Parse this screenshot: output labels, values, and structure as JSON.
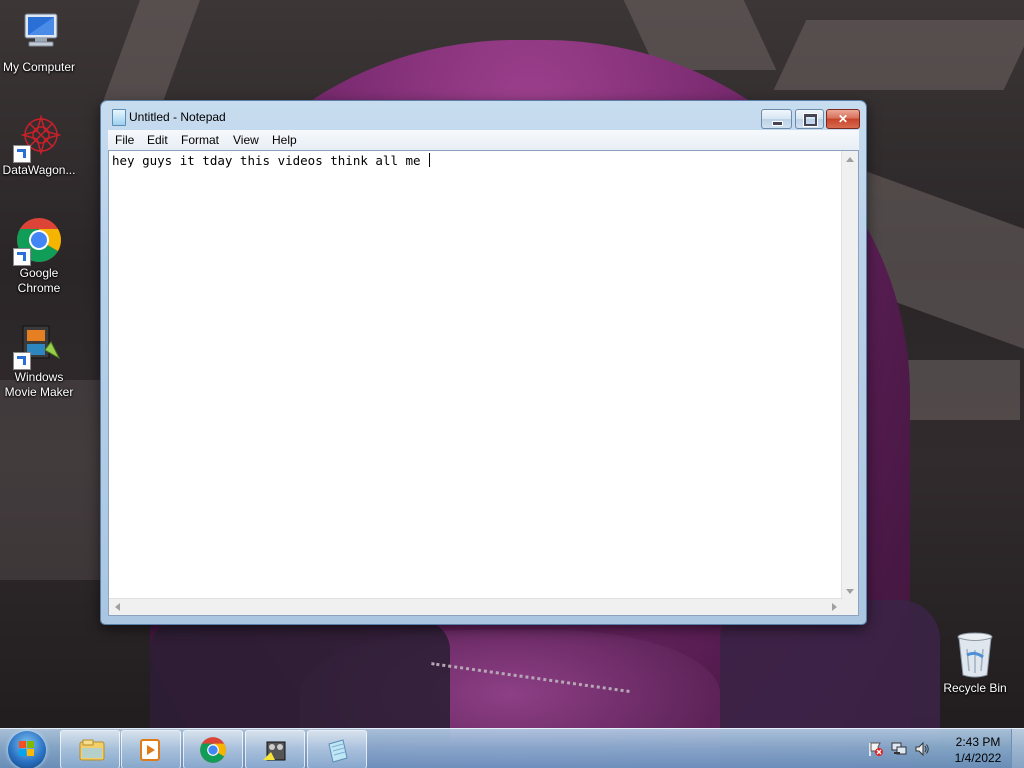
{
  "desktop": {
    "icons": [
      {
        "label": "My Computer",
        "icon": "computer-icon"
      },
      {
        "label": "DataWagon...",
        "icon": "datawagon-icon"
      },
      {
        "label": "Google Chrome",
        "icon": "chrome-icon"
      },
      {
        "label": "Windows Movie Maker",
        "icon": "movie-maker-icon"
      },
      {
        "label": "Recycle Bin",
        "icon": "recycle-bin-icon"
      }
    ]
  },
  "notepad": {
    "title": "Untitled - Notepad",
    "menu": [
      "File",
      "Edit",
      "Format",
      "View",
      "Help"
    ],
    "content": "hey guys it tday this videos think all me "
  },
  "taskbar": {
    "pinned": [
      "explorer-icon",
      "media-player-icon",
      "chrome-icon",
      "movie-maker-icon",
      "notepad-icon"
    ],
    "clock": {
      "time": "2:43 PM",
      "date": "1/4/2022"
    },
    "tray": [
      "action-center-flag-icon",
      "network-icon",
      "volume-icon"
    ]
  },
  "colors": {
    "accent": "#2b73c4",
    "title_bar": "#b9d1e8",
    "close": "#c7432b"
  }
}
